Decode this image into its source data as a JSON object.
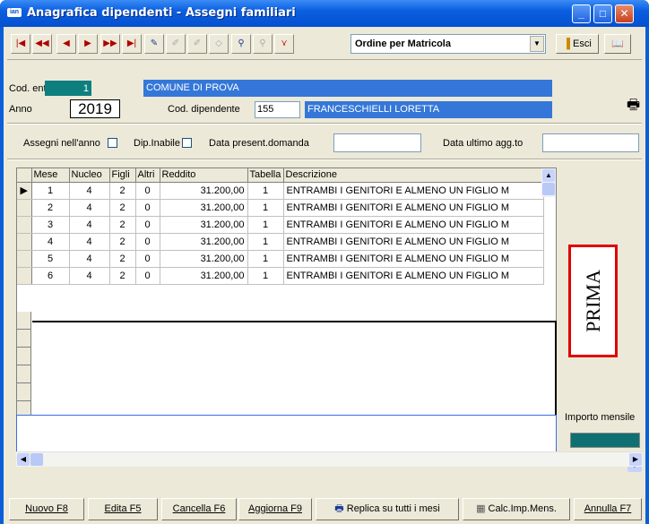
{
  "window": {
    "title": "Anagrafica dipendenti - Assegni familiari",
    "app_icon_text": "ian",
    "colors": {
      "titlebar": "#0a5fe0",
      "field_blue": "#3477d8",
      "teal": "#0e7f7f",
      "prima_border": "#e00000"
    }
  },
  "toolbar": {
    "order_select": "Ordine per Matricola",
    "exit_label": "Esci",
    "nav_icons": [
      "first-record-icon",
      "prev-page-icon",
      "prev-record-icon",
      "next-record-icon",
      "next-page-icon",
      "last-record-icon"
    ]
  },
  "header": {
    "cod_ente_label": "Cod. ente",
    "cod_ente_value": "1",
    "ente_name": "COMUNE DI PROVA",
    "anno_label": "Anno",
    "anno_value": "2019",
    "cod_dip_label": "Cod. dipendente",
    "cod_dip_value": "155",
    "dip_name": "FRANCESCHIELLI LORETTA"
  },
  "filters": {
    "assegni_label": "Assegni nell'anno",
    "inabile_label": "Dip.Inabile",
    "data_domanda_label": "Data present.domanda",
    "data_domanda_value": "",
    "data_agg_label": "Data ultimo agg.to",
    "data_agg_value": ""
  },
  "grid": {
    "columns": [
      "Mese",
      "Nucleo",
      "Figli",
      "Altri",
      "Reddito",
      "Tabella",
      "Descrizione"
    ],
    "rows": [
      [
        "1",
        "4",
        "2",
        "0",
        "31.200,00",
        "1",
        "ENTRAMBI I GENITORI E ALMENO UN FIGLIO M"
      ],
      [
        "2",
        "4",
        "2",
        "0",
        "31.200,00",
        "1",
        "ENTRAMBI I GENITORI E ALMENO UN FIGLIO M"
      ],
      [
        "3",
        "4",
        "2",
        "0",
        "31.200,00",
        "1",
        "ENTRAMBI I GENITORI E ALMENO UN FIGLIO M"
      ],
      [
        "4",
        "4",
        "2",
        "0",
        "31.200,00",
        "1",
        "ENTRAMBI I GENITORI E ALMENO UN FIGLIO M"
      ],
      [
        "5",
        "4",
        "2",
        "0",
        "31.200,00",
        "1",
        "ENTRAMBI I GENITORI E ALMENO UN FIGLIO M"
      ],
      [
        "6",
        "4",
        "2",
        "0",
        "31.200,00",
        "1",
        "ENTRAMBI I GENITORI E ALMENO UN FIGLIO M"
      ]
    ]
  },
  "side": {
    "prima": "PRIMA",
    "importo_label": "Importo mensile",
    "importo_value": ""
  },
  "buttons": {
    "nuovo": "Nuovo F8",
    "edita": "Edita F5",
    "cancella": "Cancella F6",
    "aggiorna": "Aggiorna F9",
    "replica": "Replica su tutti i mesi",
    "calc": "Calc.Imp.Mens.",
    "annulla": "Annulla F7"
  }
}
